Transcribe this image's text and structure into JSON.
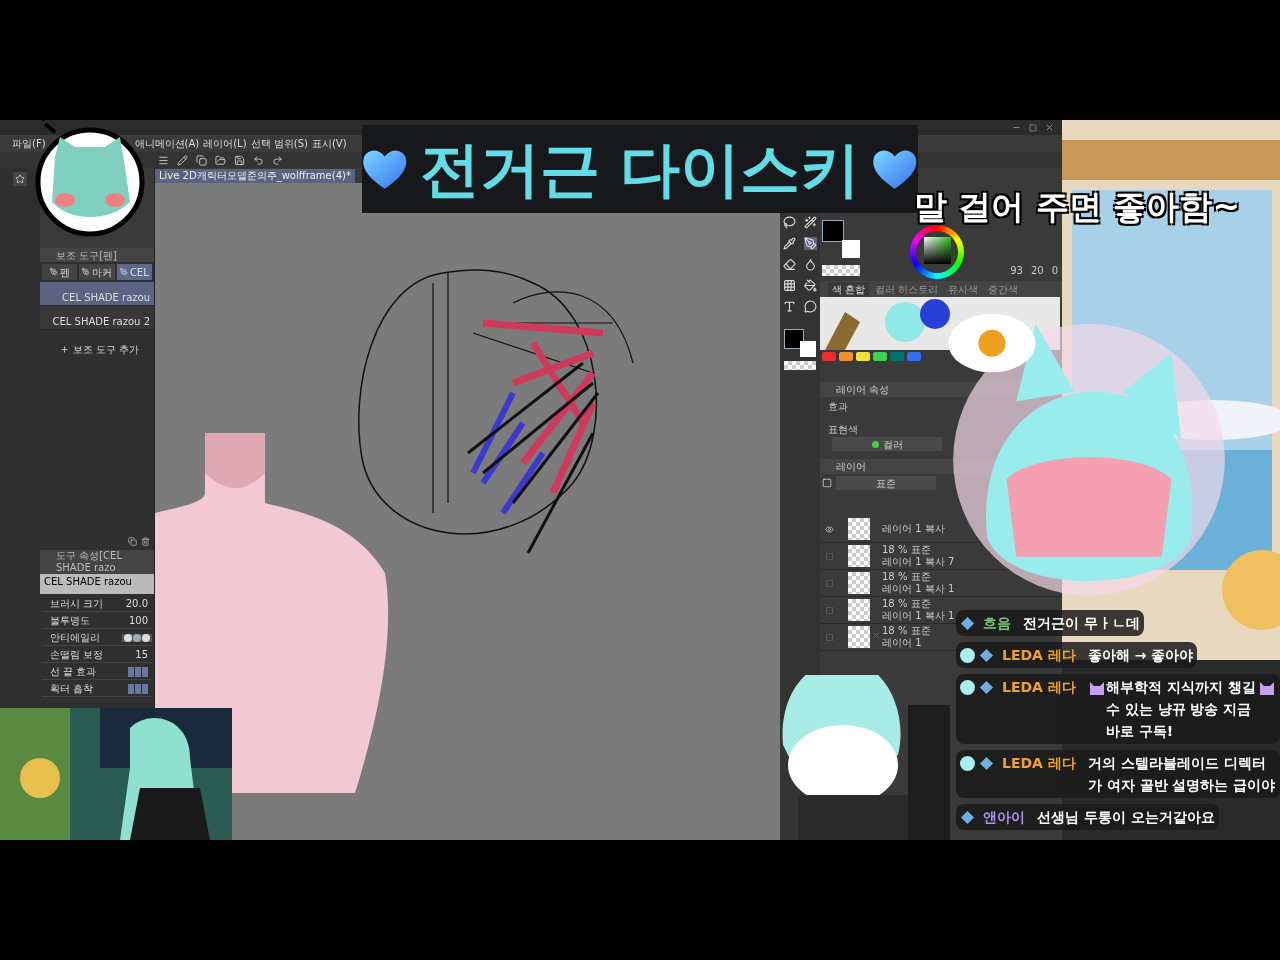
{
  "window": {
    "menu": [
      "파일(F)",
      "애니메이션(A)",
      "레이어(L)",
      "선택 범위(S)",
      "표시(V)"
    ],
    "document_tab": "Live 2D캐릭터모델준의주_wolfframe(4)*"
  },
  "sub_tool": {
    "title": "보조 도구[펜]",
    "tabs": [
      {
        "label": "펜",
        "selected": false
      },
      {
        "label": "마커",
        "selected": false
      },
      {
        "label": "CEL",
        "selected": true
      }
    ],
    "brushes": [
      {
        "name": "CEL SHADE razou",
        "selected": true
      },
      {
        "name": "CEL SHADE razou 2",
        "selected": false
      }
    ],
    "add": "보조 도구 추가"
  },
  "tool_property": {
    "title": "도구 속성[CEL SHADE razo",
    "preview": "CEL SHADE razou",
    "rows": [
      {
        "kind": "value",
        "label": "브러시 크기",
        "value": "20.0"
      },
      {
        "kind": "value",
        "label": "불투명도",
        "value": "100"
      },
      {
        "kind": "options",
        "label": "안티에일리"
      },
      {
        "kind": "value",
        "label": "손떨림 보정",
        "value": "15"
      },
      {
        "kind": "segments",
        "label": "선 끝 효과"
      },
      {
        "kind": "segments",
        "label": "획터 흡착"
      }
    ]
  },
  "color": {
    "readouts": [
      "93",
      "20",
      "0"
    ]
  },
  "color_tabs": [
    {
      "label": "색 혼합",
      "selected": true
    },
    {
      "label": "컬러 히스토리",
      "selected": false
    },
    {
      "label": "유사색",
      "selected": false
    },
    {
      "label": "중간색",
      "selected": false
    }
  ],
  "palette": [
    {
      "color": "#e83030"
    },
    {
      "color": "#f09030"
    },
    {
      "color": "#f0e040"
    },
    {
      "color": "#40d050"
    },
    {
      "color": "#007070"
    },
    {
      "color": "#3070f0"
    }
  ],
  "layer_property": {
    "tab": "레이어 속성",
    "effect": "효과",
    "expression_label": "표현색",
    "expression_value": "컬러"
  },
  "layers": {
    "tab": "레이어",
    "blend": "표준",
    "items": [
      {
        "name": "레이어 1 복사",
        "visible": true,
        "excluded": false
      },
      {
        "mode": "18 % 표준",
        "name": "레이어 1 복사 7",
        "visible": false,
        "excluded": false
      },
      {
        "mode": "18 % 표준",
        "name": "레이어 1 복사 1",
        "visible": false,
        "excluded": false
      },
      {
        "mode": "18 % 표준",
        "name": "레이어 1 복사 1",
        "visible": false,
        "excluded": false
      },
      {
        "mode": "18 % 표준",
        "name": "레이어 1",
        "visible": false,
        "excluded": true
      }
    ]
  },
  "banner": {
    "title": "전거근 다이스키",
    "caption": "말 걸어 주면 좋아함~"
  },
  "chat": [
    {
      "user": "흐음",
      "color": "#7ac87a",
      "dot": false,
      "parts": [
        {
          "kind": "text",
          "text": "전거근이 무ㅏㄴ데"
        }
      ]
    },
    {
      "user": "LEDA 레다",
      "color": "#f0a030",
      "dot": true,
      "parts": [
        {
          "kind": "text",
          "text": "좋아해 → 좋아야"
        }
      ]
    },
    {
      "user": "LEDA 레다",
      "color": "#f0a030",
      "dot": true,
      "parts": [
        {
          "kind": "emote"
        },
        {
          "kind": "text",
          "text": "해부학적 지식까지 챙길 수 있는 냥뀨 방송 지금 바로 구독!"
        },
        {
          "kind": "emote"
        }
      ]
    },
    {
      "user": "LEDA 레다",
      "color": "#f0a030",
      "dot": true,
      "parts": [
        {
          "kind": "text",
          "text": "거의 스텔라블레이드 디렉터가 여자 골반 설명하는 급이야"
        }
      ]
    },
    {
      "user": "앤아이",
      "color": "#b090f0",
      "dot": false,
      "parts": [
        {
          "kind": "text",
          "text": "선생님 두통이 오는거같아요"
        }
      ]
    }
  ]
}
